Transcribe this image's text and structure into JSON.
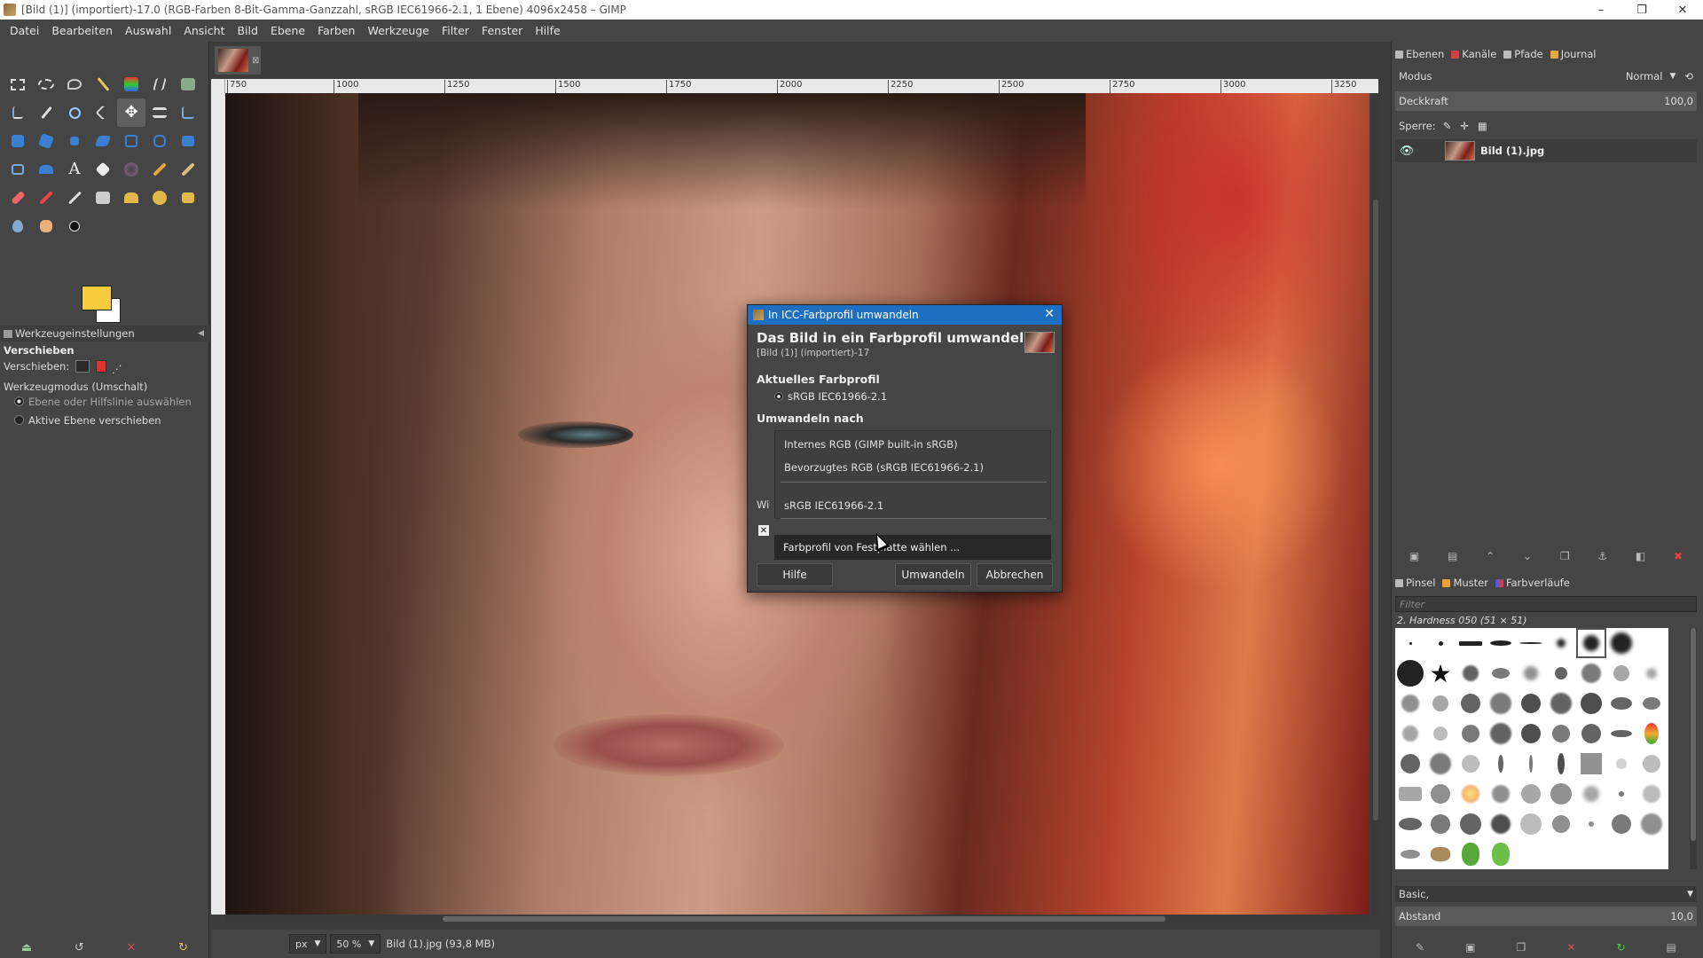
{
  "window": {
    "title": "[Bild (1)] (importiert)-17.0 (RGB-Farben 8-Bit-Gamma-Ganzzahl, sRGB IEC61966-2.1, 1 Ebene) 4096x2458 – GIMP",
    "controls": [
      "–",
      "❐",
      "✕"
    ]
  },
  "menu": [
    "Datei",
    "Bearbeiten",
    "Auswahl",
    "Ansicht",
    "Bild",
    "Ebene",
    "Farben",
    "Werkzeuge",
    "Filter",
    "Fenster",
    "Hilfe"
  ],
  "ruler_labels": [
    "750",
    "1000",
    "1250",
    "1500",
    "1750",
    "2000",
    "2250",
    "2500",
    "2750",
    "3000",
    "3250"
  ],
  "tool_options": {
    "tab": "Werkzeugeinstellungen",
    "tool_name": "Verschieben",
    "move_label": "Verschieben:",
    "mode_label": "Werkzeugmodus (Umschalt)",
    "option_1": "Ebene oder Hilfslinie auswählen",
    "option_2": "Aktive Ebene verschieben"
  },
  "colors": {
    "foreground": "#f7cd3e",
    "background": "#ffffff",
    "dialog_title": "#1e6fc1"
  },
  "status": {
    "unit": "px",
    "zoom": "50 %",
    "file_info": "Bild (1).jpg (93,8 MB)"
  },
  "layers": {
    "tabs": [
      "Ebenen",
      "Kanäle",
      "Pfade",
      "Journal"
    ],
    "mode_label": "Modus",
    "mode_value": "Normal",
    "opacity_label": "Deckkraft",
    "opacity_value": "100,0",
    "lock_label": "Sperre:",
    "layer_name": "Bild (1).jpg"
  },
  "brushes": {
    "tabs": [
      "Pinsel",
      "Muster",
      "Farbverläufe"
    ],
    "filter_placeholder": "Filter",
    "selected_brush": "2. Hardness 050 (51 × 51)",
    "preset": "Basic,",
    "spacing_label": "Abstand",
    "spacing_value": "10,0"
  },
  "dialog": {
    "title": "In ICC-Farbprofil umwandeln",
    "heading": "Das Bild in ein Farbprofil umwandeln",
    "subheading": "[Bild (1)] (importiert)-17",
    "current_section": "Aktuelles Farbprofil",
    "current_profile": "sRGB IEC61966-2.1",
    "convert_section": "Umwandeln nach",
    "options": [
      "Internes RGB (GIMP built-in sRGB)",
      "Bevorzugtes RGB (sRGB IEC61966-2.1)",
      "sRGB IEC61966-2.1"
    ],
    "partial_label": "Wi",
    "choose_from_disk": "Farbprofil von Festplatte wählen ...",
    "buttons": {
      "help": "Hilfe",
      "convert": "Umwandeln",
      "cancel": "Abbrechen"
    }
  }
}
